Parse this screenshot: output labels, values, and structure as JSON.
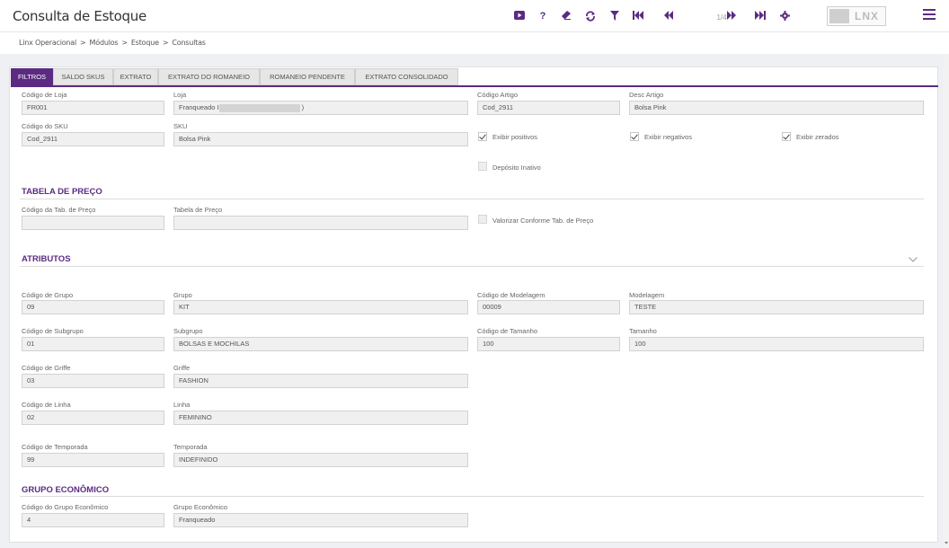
{
  "header": {
    "title": "Consulta de Estoque",
    "pager": "1/4",
    "logo_text": "LNX",
    "brand_color": "#5b2b82",
    "toolbar_icons": [
      "youtube-icon",
      "help-icon",
      "eraser-icon",
      "refresh-icon",
      "filter-icon",
      "first-page-icon",
      "prev-page-icon",
      "next-page-icon",
      "last-page-icon",
      "settings-icon",
      "menu-icon"
    ]
  },
  "breadcrumb": {
    "items": [
      "Linx Operacional",
      "Módulos",
      "Estoque",
      "Consultas"
    ],
    "separator": ">"
  },
  "tabs": [
    "FILTROS",
    "SALDO SKUS",
    "EXTRATO",
    "EXTRATO DO ROMANEIO",
    "ROMANEIO PENDENTE",
    "EXTRATO CONSOLIDADO"
  ],
  "active_tab": "FILTROS",
  "filtros": {
    "codigo_loja": {
      "label": "Código de Loja",
      "value": "FR001"
    },
    "loja": {
      "label": "Loja",
      "value_prefix": "Franqueado I",
      "value_suffix": ")"
    },
    "codigo_artigo": {
      "label": "Código Artigo",
      "value": "Cod_2911"
    },
    "desc_artigo": {
      "label": "Desc Artigo",
      "value": "Bolsa Pink"
    },
    "codigo_sku": {
      "label": "Código do SKU",
      "value": "Cod_2911"
    },
    "sku": {
      "label": "SKU",
      "value": "Bolsa Pink"
    },
    "exibir_positivos": {
      "label": "Exibir positivos",
      "checked": true
    },
    "exibir_negativos": {
      "label": "Exibir negativos",
      "checked": true
    },
    "exibir_zerados": {
      "label": "Exibir zerados",
      "checked": true
    },
    "deposito_inativo": {
      "label": "Depósito Inativo",
      "checked": false
    }
  },
  "tabela_preco": {
    "title": "TABELA DE PREÇO",
    "codigo": {
      "label": "Código da Tab. de Preço",
      "value": ""
    },
    "tabela": {
      "label": "Tabela de Preço",
      "value": ""
    },
    "valorizar": {
      "label": "Valorizar Conforme Tab. de Preço",
      "checked": false
    }
  },
  "atributos": {
    "title": "ATRIBUTOS",
    "codigo_grupo": {
      "label": "Código de Grupo",
      "value": "09"
    },
    "grupo": {
      "label": "Grupo",
      "value": "KIT"
    },
    "codigo_modelagem": {
      "label": "Código de Modelagem",
      "value": "00009"
    },
    "modelagem": {
      "label": "Modelagem",
      "value": "TESTE"
    },
    "codigo_subgrupo": {
      "label": "Código de Subgrupo",
      "value": "01"
    },
    "subgrupo": {
      "label": "Subgrupo",
      "value": "BOLSAS E MOCHILAS"
    },
    "codigo_tamanho": {
      "label": "Código de Tamanho",
      "value": "100"
    },
    "tamanho": {
      "label": "Tamanho",
      "value": "100"
    },
    "codigo_griffe": {
      "label": "Código de Griffe",
      "value": "03"
    },
    "griffe": {
      "label": "Griffe",
      "value": "FASHION"
    },
    "codigo_linha": {
      "label": "Código de Linha",
      "value": "02"
    },
    "linha": {
      "label": "Linha",
      "value": "FEMININO"
    },
    "codigo_temporada": {
      "label": "Código de Temporada",
      "value": "99"
    },
    "temporada": {
      "label": "Temporada",
      "value": "INDEFINIDO"
    }
  },
  "grupo_economico": {
    "title": "GRUPO ECONÔMICO",
    "codigo": {
      "label": "Código do Grupo Econômico",
      "value": "4"
    },
    "grupo": {
      "label": "Grupo Econômico",
      "value": "Franqueado"
    }
  }
}
